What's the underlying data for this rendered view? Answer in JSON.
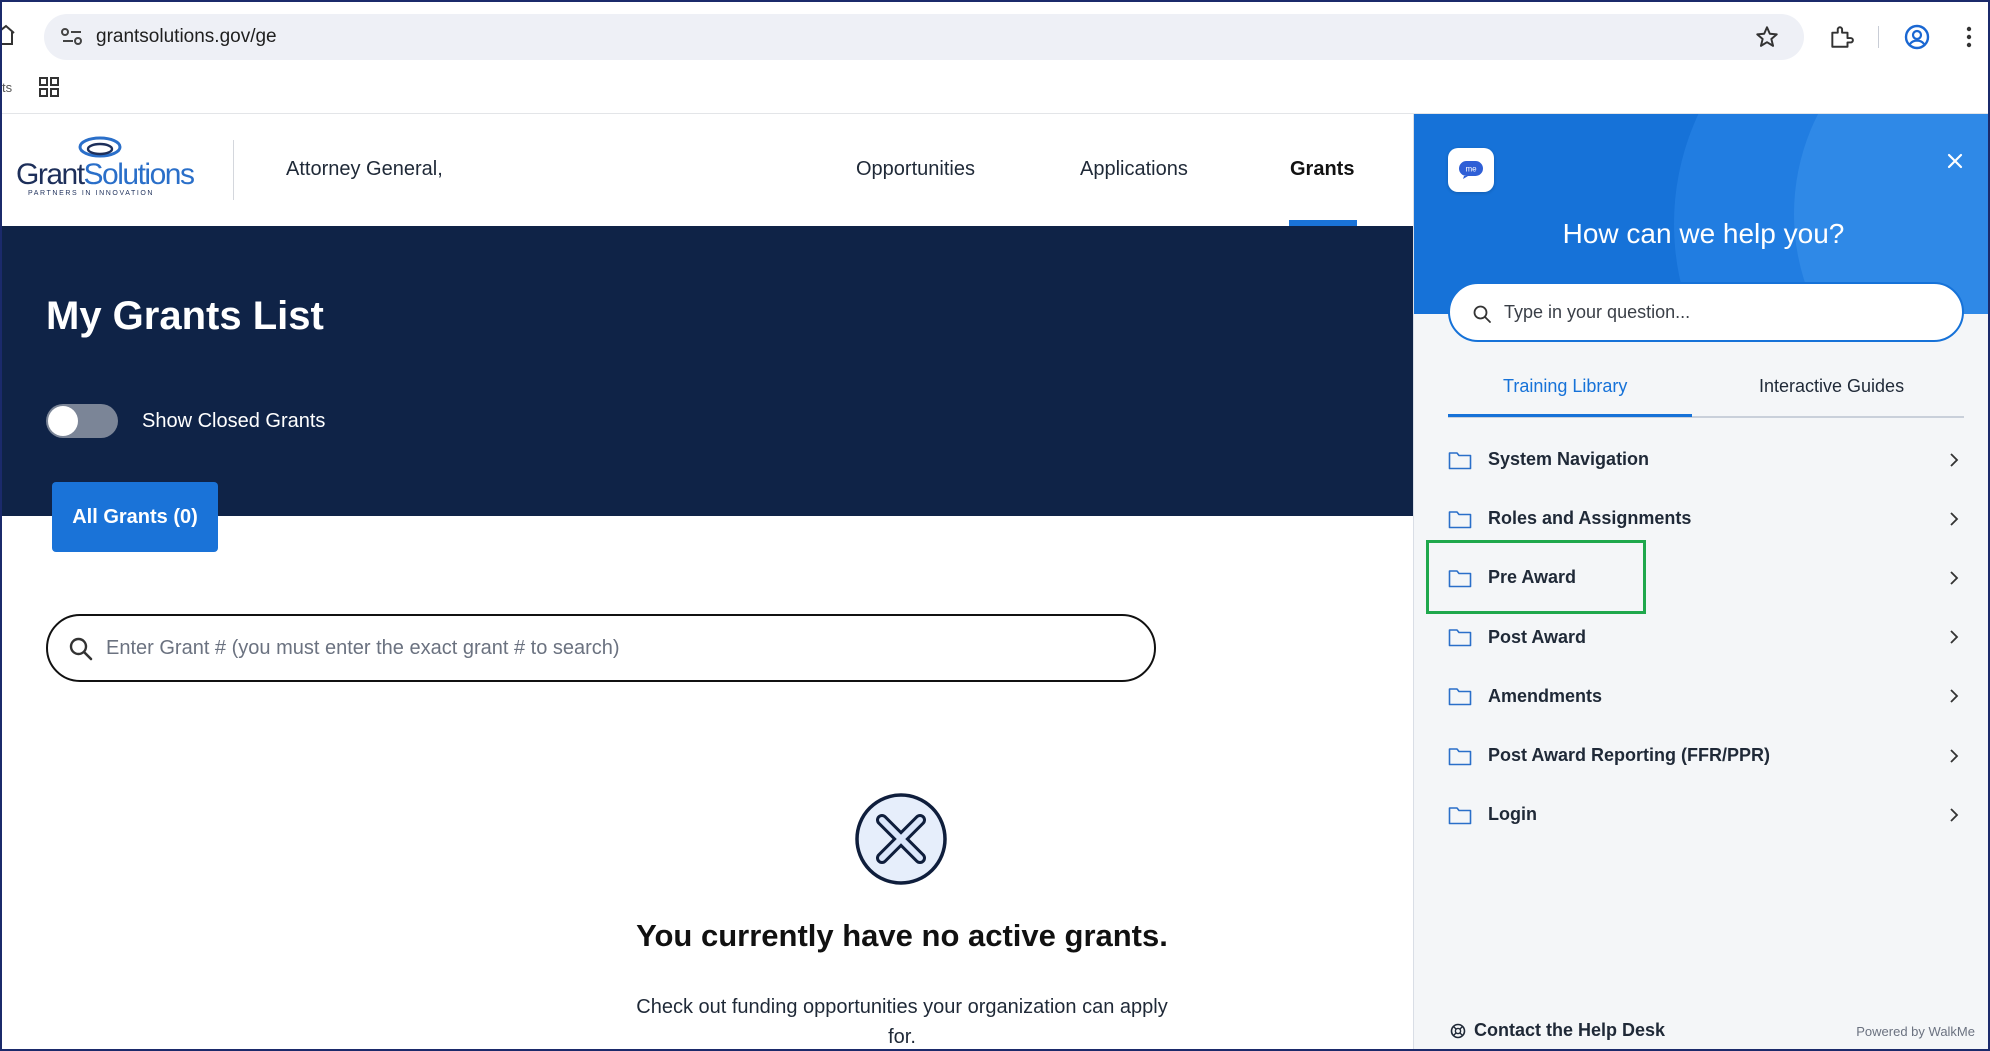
{
  "browser": {
    "url": "grantsolutions.gov/ge",
    "bookmark_fragment": "ts"
  },
  "site": {
    "logo": {
      "name_part1": "Grant",
      "name_part2": "Solutions",
      "tagline": "PARTNERS IN INNOVATION"
    },
    "user": "Attorney General,",
    "nav": {
      "opportunities": "Opportunities",
      "applications": "Applications",
      "grants": "Grants"
    }
  },
  "hero": {
    "title": "My Grants List",
    "toggle_label": "Show Closed Grants",
    "toggle_on": false,
    "tab_all": "All Grants (0)"
  },
  "search": {
    "placeholder": "Enter Grant # (you must enter the exact grant # to search)"
  },
  "empty_state": {
    "title": "You currently have no active grants.",
    "subtitle": "Check out funding opportunities your organization can apply for."
  },
  "walkme": {
    "logo_text": "me",
    "heading": "How can we help you?",
    "search_placeholder": "Type in your question...",
    "tabs": [
      "Training Library",
      "Interactive Guides"
    ],
    "items": [
      {
        "label": "System Navigation"
      },
      {
        "label": "Roles and Assignments"
      },
      {
        "label": "Pre Award"
      },
      {
        "label": "Post Award"
      },
      {
        "label": "Amendments"
      },
      {
        "label": "Post Award Reporting (FFR/PPR)"
      },
      {
        "label": "Login"
      }
    ],
    "help_desk": "Contact the Help Desk",
    "powered_by": "Powered by WalkMe"
  },
  "colors": {
    "hero_bg": "#0f2347",
    "accent": "#1a73d8",
    "walkme_blue": "#1672d8",
    "highlight": "#1fa84c"
  }
}
